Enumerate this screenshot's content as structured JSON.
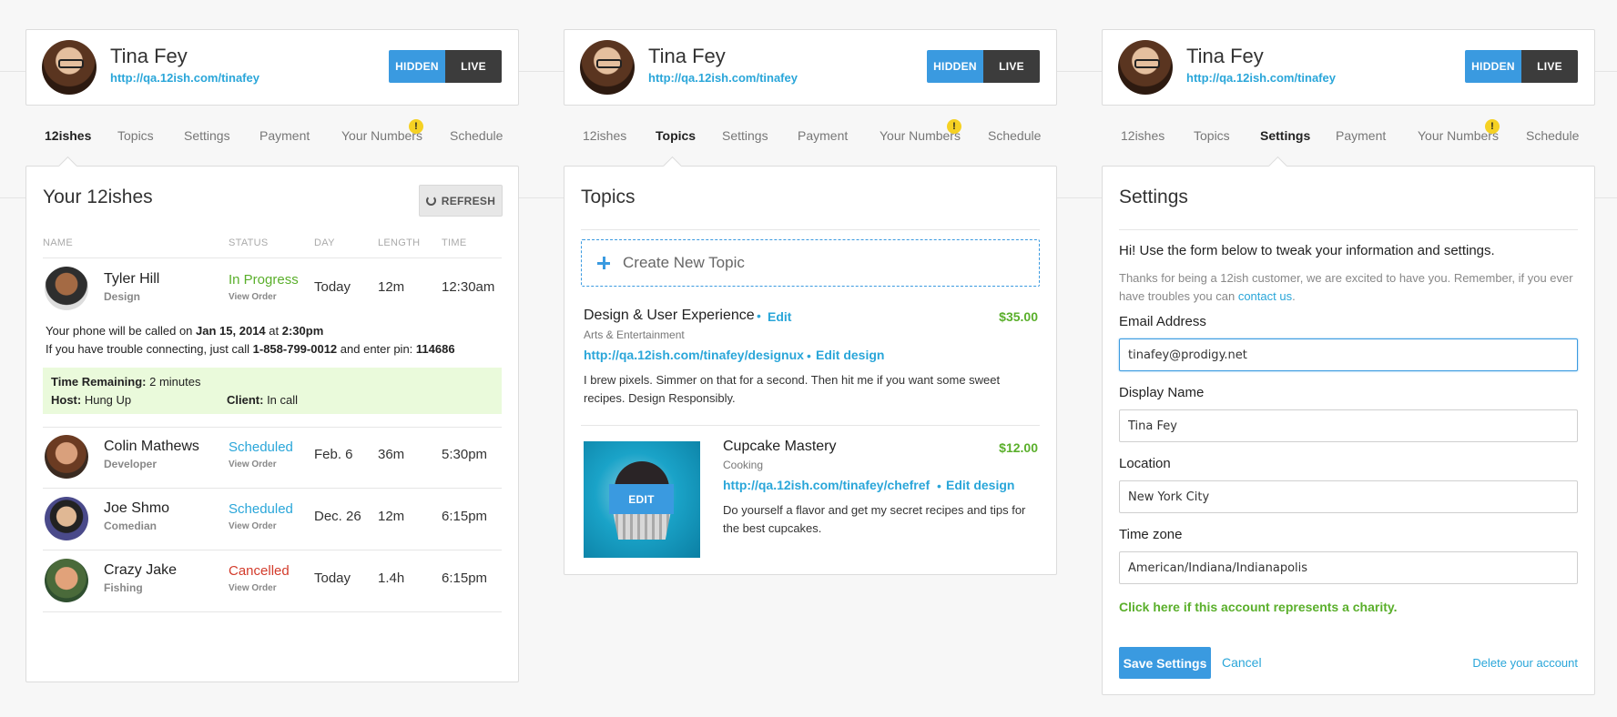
{
  "profile": {
    "name": "Tina Fey",
    "url": "http://qa.12ish.com/tinafey",
    "hidden_label": "HIDDEN",
    "live_label": "LIVE"
  },
  "tabs": [
    "12ishes",
    "Topics",
    "Settings",
    "Payment",
    "Your Numbers",
    "Schedule"
  ],
  "warning_glyph": "!",
  "twelveishes": {
    "title": "Your 12ishes",
    "refresh_label": "REFRESH",
    "columns": [
      "NAME",
      "STATUS",
      "DAY",
      "LENGTH",
      "TIME"
    ],
    "view_order_label": "View Order",
    "rows": [
      {
        "name": "Tyler Hill",
        "role": "Design",
        "status": "In Progress",
        "day": "Today",
        "length": "12m",
        "time": "12:30am"
      },
      {
        "name": "Colin Mathews",
        "role": "Developer",
        "status": "Scheduled",
        "day": "Feb. 6",
        "length": "36m",
        "time": "5:30pm"
      },
      {
        "name": "Joe Shmo",
        "role": "Comedian",
        "status": "Scheduled",
        "day": "Dec. 26",
        "length": "12m",
        "time": "6:15pm"
      },
      {
        "name": "Crazy Jake",
        "role": "Fishing",
        "status": "Cancelled",
        "day": "Today",
        "length": "1.4h",
        "time": "6:15pm"
      }
    ],
    "call_info": {
      "line1_prefix": "Your phone will be called on ",
      "date": "Jan 15, 2014",
      "line1_mid": " at ",
      "time": "2:30pm",
      "line2_prefix": "If you have trouble connecting, just call ",
      "phone": "1-858-799-0012",
      "line2_mid": " and enter pin: ",
      "pin": "114686"
    },
    "time_remaining": {
      "remaining_label": "Time Remaining:",
      "remaining_value": " 2 minutes",
      "host_label": "Host:",
      "host_value": " Hung Up",
      "client_label": "Client:",
      "client_value": " In call"
    }
  },
  "topics": {
    "title": "Topics",
    "create_label": "Create New Topic",
    "edit_label": "Edit",
    "edit_design_label": "Edit design",
    "dot": "•",
    "image_edit_label": "EDIT",
    "items": [
      {
        "title": "Design & User Experience",
        "category": "Arts & Entertainment",
        "price": "$35.00",
        "url": "http://qa.12ish.com/tinafey/designux",
        "desc": "I brew pixels. Simmer on that for a second. Then hit me if you want some sweet recipes. Design Responsibly."
      },
      {
        "title": "Cupcake Mastery",
        "category": "Cooking",
        "price": "$12.00",
        "url": "http://qa.12ish.com/tinafey/chefref",
        "desc": "Do yourself a flavor and get my secret recipes and tips for the best cupcakes."
      }
    ]
  },
  "settings": {
    "title": "Settings",
    "intro": "Hi! Use the form below to tweak your information and settings.",
    "thanks": "Thanks for being a 12ish customer, we are excited to have you. Remember, if you ever have troubles you can ",
    "contact_label": "contact us",
    "period": ".",
    "fields": [
      {
        "label": "Email Address",
        "value": "tinafey@prodigy.net"
      },
      {
        "label": "Display Name",
        "value": "Tina Fey"
      },
      {
        "label": "Location",
        "value": "New York City"
      },
      {
        "label": "Time zone",
        "value": "American/Indiana/Indianapolis"
      }
    ],
    "charity_label": "Click here if this account represents a charity.",
    "save_label": "Save Settings",
    "cancel_label": "Cancel",
    "delete_label": "Delete your account"
  },
  "colors": {
    "accent_blue": "#3a9ae0",
    "link_blue": "#2aa6d9",
    "green": "#5aaf2b",
    "red": "#d33b2b",
    "warning_yellow": "#f5d123"
  }
}
